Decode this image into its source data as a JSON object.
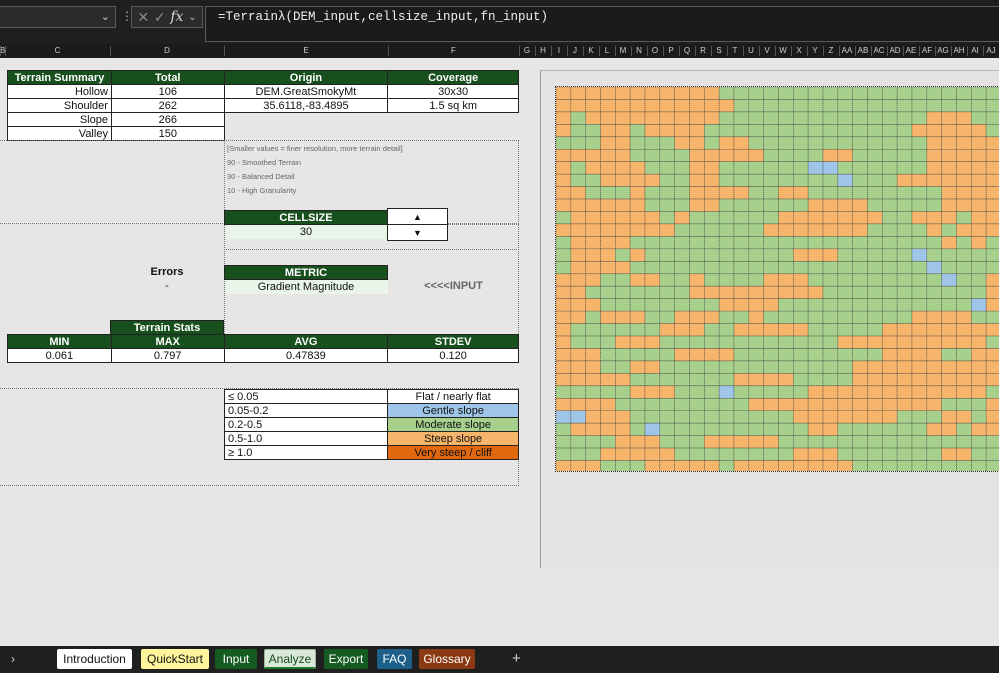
{
  "formula_bar": {
    "fx_label": "fx",
    "cancel_icon": "✕",
    "confirm_icon": "✓",
    "formula": "=Terrainλ(DEM_input,cellsize_input,fn_input)"
  },
  "columns": [
    "B",
    "C",
    "D",
    "E",
    "F",
    "G",
    "H",
    "I",
    "J",
    "K",
    "L",
    "M",
    "N",
    "O",
    "P",
    "Q",
    "R",
    "S",
    "T",
    "U",
    "V",
    "W",
    "X",
    "Y",
    "Z",
    "AA",
    "AB",
    "AC",
    "AD",
    "AE",
    "AF",
    "AG",
    "AH",
    "AI",
    "AJ"
  ],
  "summary": {
    "headers": [
      "Terrain Summary",
      "Total",
      "Origin",
      "Coverage"
    ],
    "rows": [
      {
        "label": "Hollow",
        "total": "106",
        "origin": "DEM.GreatSmokyMt",
        "coverage": "30x30"
      },
      {
        "label": "Shoulder",
        "total": "262",
        "origin": "35.6118,-83.4895",
        "coverage": "1.5 sq km"
      },
      {
        "label": "Slope",
        "total": "266"
      },
      {
        "label": "Valley",
        "total": "150"
      }
    ]
  },
  "cellsize_notes": [
    "[Smaller values = finer resolution, more terrain detail]",
    "90 - Smoothed Terrain",
    "30 - Balanced Detail",
    "10 - High Granularity"
  ],
  "cellsize": {
    "label": "CELLSIZE",
    "value": "30",
    "up_icon": "▲",
    "down_icon": "▼"
  },
  "errors": {
    "label": "Errors",
    "value": "-"
  },
  "metric": {
    "label": "METRIC",
    "value": "Gradient Magnitude",
    "input_hint": "<<<<INPUT"
  },
  "stats": {
    "title": "Terrain Stats",
    "headers": [
      "MIN",
      "MAX",
      "AVG",
      "STDEV"
    ],
    "values": [
      "0.061",
      "0.797",
      "0.47839",
      "0.120"
    ]
  },
  "legend": [
    {
      "range": "≤ 0.05",
      "label": "Flat / nearly flat",
      "color": "#ffffff"
    },
    {
      "range": "0.05-0.2",
      "label": "Gentle slope",
      "color": "#9fc5e8"
    },
    {
      "range": "0.2-0.5",
      "label": "Moderate slope",
      "color": "#a8d08d"
    },
    {
      "range": "0.5-1.0",
      "label": "Steep slope",
      "color": "#f7b46b"
    },
    {
      "range": "≥ 1.0",
      "label": "Very steep / cliff",
      "color": "#e2680f"
    }
  ],
  "heatmap": {
    "palette": {
      "O": "#f7b46b",
      "G": "#a8d08d",
      "B": "#9fc5e8"
    },
    "rows": [
      "OOOOOOOOOOOGGGGGGGGGGGGGGGGGGG",
      "OOOOOOOOOOOOGGGGGGGGGGGGGGGGGG",
      "OGOOOOOOOOOGGGGGGGGGGGGGGOOOGG",
      "OGGOOGOOOOGGGGGGGGGGGGGGOOOOOG",
      "GGGOOGGGOOGOOGGGGGGGGGGGGOOOOO",
      "OOOOOGGGGOOOOOGGGGOOGGGGGOOOOO",
      "OGOOOOGGGOOGGGGGGBBGGGGGGOOOOO",
      "OGGOOOOGGOOGGGGGGGGBGGGOOOOOOO",
      "OOGGGOGGGOOOOGGOOGGGGGGGGGOOOO",
      "OOOOOOGGGOOGGGGGGOOOOGGGGGOOOO",
      "GOOOOOOGOGGGGGGOOOOOOOGGOOOGOO",
      "OOOOOOOOGGGGGGOOOOOOOGGGGOGOOO",
      "GOOOOGGGGGGGGGGGGGGGGGGGGGOGOG",
      "GOOOGOGGGGGGGGGGOOOGGGGGBGGGGG",
      "GOOOOGGGGGGGGGGGGGGGGGGGGBGGGG",
      "OOOGGOOGGOGGGGOOOGGGGGGGGGBGGO",
      "OOGGGGGGGOOOOOOOOOGGGGGGGGGGGO",
      "OOOGGGGGGGGOOOOGGGGGGGGGGGGGBO",
      "OOGOOOGGOOOGGOGGGGGGGGGGOOOOGG",
      "OGGGGGGOOOGGOOOOOGGGGGOOOOOOOO",
      "OGGGOOOGGGGGGGGGGGGOOOOOOOOOOG",
      "OOOGGGGGOOOOGGGGGGGGGGOOOOGGOO",
      "OOOGGOOGGGGGGGGGGGGGOOOOOOOOOO",
      "OOOOOGGGGGGGOOOOGGGGOOOOOOOOOO",
      "GGGGGOOOGGGBGGGGGOOOOOOOOOOOOG",
      "OOOOGGGGGGGGGOOOOOOOOOOOOOGGGO",
      "BBOOOGGGGGGGGGGGOOOOOOOGGGOOGO",
      "GOOOOGBGGGGGGGGGGOOGGGGGGOOGOO",
      "GGGGOOOGGGOOOOOGGGGGGGGGGGGGGG",
      "GGGOOOOOGGGGGGGGOOOGGGGGGGOOGG",
      "OOOGGGOOOOOGOOOOOOOOGGGGGGGGGG"
    ]
  },
  "tabs": [
    {
      "label": "Introduction",
      "bg": "#ffffff",
      "fg": "#111111"
    },
    {
      "label": "QuickStart",
      "bg": "#fff59d",
      "fg": "#111111"
    },
    {
      "label": "Input",
      "bg": "#155a20",
      "fg": "#ffffff"
    },
    {
      "label": "Analyze",
      "bg": "#d9e8d9",
      "fg": "#174f1d"
    },
    {
      "label": "Export",
      "bg": "#155a20",
      "fg": "#ffffff"
    },
    {
      "label": "FAQ",
      "bg": "#1c5f8a",
      "fg": "#ffffff"
    },
    {
      "label": "Glossary",
      "bg": "#8b3a13",
      "fg": "#ffffff"
    }
  ],
  "add_sheet_icon": "+",
  "nav_icon": "›"
}
